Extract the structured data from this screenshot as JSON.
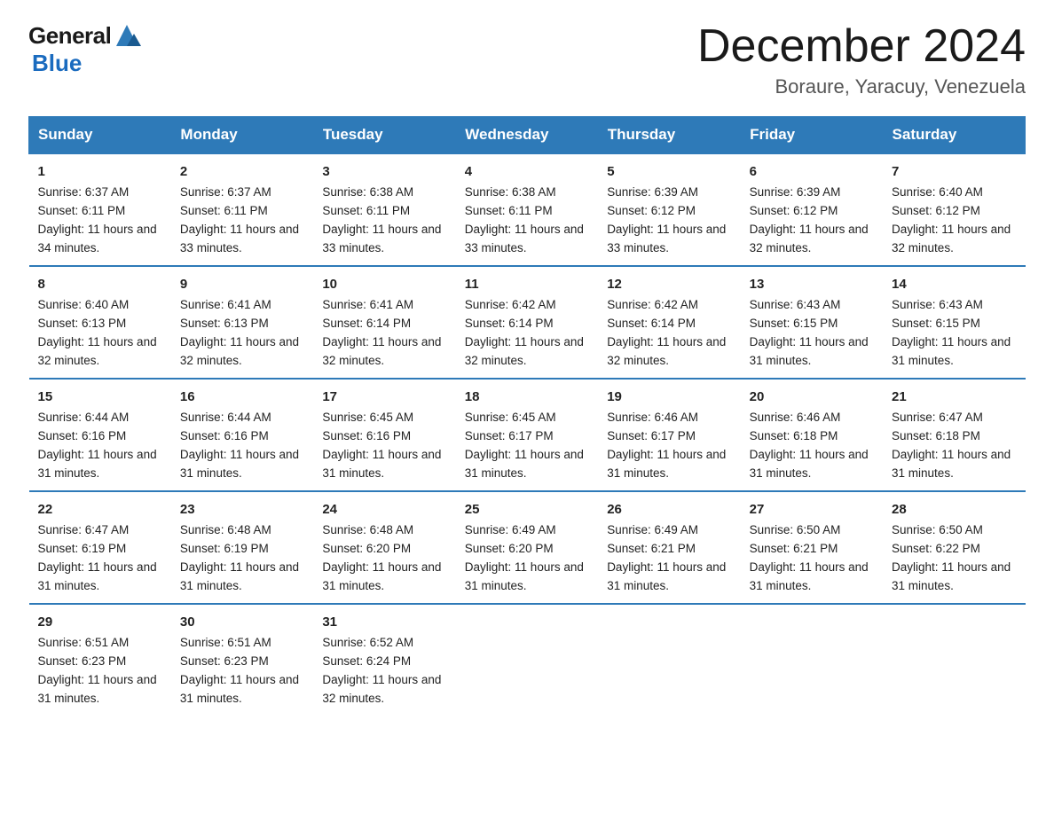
{
  "header": {
    "logo_general": "General",
    "logo_blue": "Blue",
    "title": "December 2024",
    "subtitle": "Boraure, Yaracuy, Venezuela"
  },
  "days_of_week": [
    "Sunday",
    "Monday",
    "Tuesday",
    "Wednesday",
    "Thursday",
    "Friday",
    "Saturday"
  ],
  "weeks": [
    [
      {
        "day": "1",
        "sunrise": "6:37 AM",
        "sunset": "6:11 PM",
        "daylight": "11 hours and 34 minutes."
      },
      {
        "day": "2",
        "sunrise": "6:37 AM",
        "sunset": "6:11 PM",
        "daylight": "11 hours and 33 minutes."
      },
      {
        "day": "3",
        "sunrise": "6:38 AM",
        "sunset": "6:11 PM",
        "daylight": "11 hours and 33 minutes."
      },
      {
        "day": "4",
        "sunrise": "6:38 AM",
        "sunset": "6:11 PM",
        "daylight": "11 hours and 33 minutes."
      },
      {
        "day": "5",
        "sunrise": "6:39 AM",
        "sunset": "6:12 PM",
        "daylight": "11 hours and 33 minutes."
      },
      {
        "day": "6",
        "sunrise": "6:39 AM",
        "sunset": "6:12 PM",
        "daylight": "11 hours and 32 minutes."
      },
      {
        "day": "7",
        "sunrise": "6:40 AM",
        "sunset": "6:12 PM",
        "daylight": "11 hours and 32 minutes."
      }
    ],
    [
      {
        "day": "8",
        "sunrise": "6:40 AM",
        "sunset": "6:13 PM",
        "daylight": "11 hours and 32 minutes."
      },
      {
        "day": "9",
        "sunrise": "6:41 AM",
        "sunset": "6:13 PM",
        "daylight": "11 hours and 32 minutes."
      },
      {
        "day": "10",
        "sunrise": "6:41 AM",
        "sunset": "6:14 PM",
        "daylight": "11 hours and 32 minutes."
      },
      {
        "day": "11",
        "sunrise": "6:42 AM",
        "sunset": "6:14 PM",
        "daylight": "11 hours and 32 minutes."
      },
      {
        "day": "12",
        "sunrise": "6:42 AM",
        "sunset": "6:14 PM",
        "daylight": "11 hours and 32 minutes."
      },
      {
        "day": "13",
        "sunrise": "6:43 AM",
        "sunset": "6:15 PM",
        "daylight": "11 hours and 31 minutes."
      },
      {
        "day": "14",
        "sunrise": "6:43 AM",
        "sunset": "6:15 PM",
        "daylight": "11 hours and 31 minutes."
      }
    ],
    [
      {
        "day": "15",
        "sunrise": "6:44 AM",
        "sunset": "6:16 PM",
        "daylight": "11 hours and 31 minutes."
      },
      {
        "day": "16",
        "sunrise": "6:44 AM",
        "sunset": "6:16 PM",
        "daylight": "11 hours and 31 minutes."
      },
      {
        "day": "17",
        "sunrise": "6:45 AM",
        "sunset": "6:16 PM",
        "daylight": "11 hours and 31 minutes."
      },
      {
        "day": "18",
        "sunrise": "6:45 AM",
        "sunset": "6:17 PM",
        "daylight": "11 hours and 31 minutes."
      },
      {
        "day": "19",
        "sunrise": "6:46 AM",
        "sunset": "6:17 PM",
        "daylight": "11 hours and 31 minutes."
      },
      {
        "day": "20",
        "sunrise": "6:46 AM",
        "sunset": "6:18 PM",
        "daylight": "11 hours and 31 minutes."
      },
      {
        "day": "21",
        "sunrise": "6:47 AM",
        "sunset": "6:18 PM",
        "daylight": "11 hours and 31 minutes."
      }
    ],
    [
      {
        "day": "22",
        "sunrise": "6:47 AM",
        "sunset": "6:19 PM",
        "daylight": "11 hours and 31 minutes."
      },
      {
        "day": "23",
        "sunrise": "6:48 AM",
        "sunset": "6:19 PM",
        "daylight": "11 hours and 31 minutes."
      },
      {
        "day": "24",
        "sunrise": "6:48 AM",
        "sunset": "6:20 PM",
        "daylight": "11 hours and 31 minutes."
      },
      {
        "day": "25",
        "sunrise": "6:49 AM",
        "sunset": "6:20 PM",
        "daylight": "11 hours and 31 minutes."
      },
      {
        "day": "26",
        "sunrise": "6:49 AM",
        "sunset": "6:21 PM",
        "daylight": "11 hours and 31 minutes."
      },
      {
        "day": "27",
        "sunrise": "6:50 AM",
        "sunset": "6:21 PM",
        "daylight": "11 hours and 31 minutes."
      },
      {
        "day": "28",
        "sunrise": "6:50 AM",
        "sunset": "6:22 PM",
        "daylight": "11 hours and 31 minutes."
      }
    ],
    [
      {
        "day": "29",
        "sunrise": "6:51 AM",
        "sunset": "6:23 PM",
        "daylight": "11 hours and 31 minutes."
      },
      {
        "day": "30",
        "sunrise": "6:51 AM",
        "sunset": "6:23 PM",
        "daylight": "11 hours and 31 minutes."
      },
      {
        "day": "31",
        "sunrise": "6:52 AM",
        "sunset": "6:24 PM",
        "daylight": "11 hours and 32 minutes."
      },
      null,
      null,
      null,
      null
    ]
  ]
}
